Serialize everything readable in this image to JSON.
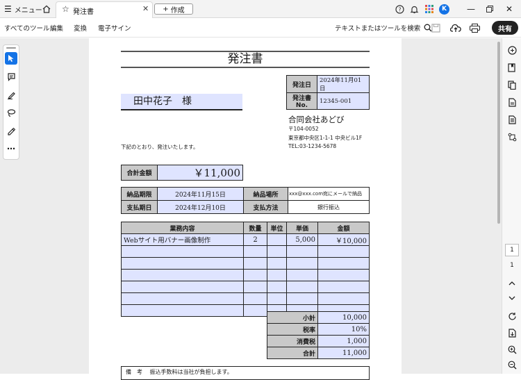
{
  "titlebar": {
    "menu_label": "メニュー",
    "tab_title": "発注書",
    "new_tab_label": "作成",
    "avatar_letter": "K"
  },
  "toolbar": {
    "all_tools": "すべてのツール",
    "edit": "編集",
    "convert": "変換",
    "esign": "電子サイン",
    "search_label": "テキストまたはツールを検索",
    "share": "共有"
  },
  "page_nav": {
    "current_page": "1",
    "total_pages": "1"
  },
  "document": {
    "title": "発注書",
    "order_date_label": "発注日",
    "order_date": "2024年11月01日",
    "order_no_label": "発注書No.",
    "order_no": "12345-001",
    "recipient": "田中花子　様",
    "company_name": "合同会社あどび",
    "postal": "〒104-0052",
    "address": "東京都中央区1-1-1 中央ビル1F",
    "tel": "TEL:03-1234-5678",
    "intro": "下記のとおり、発注いたします。",
    "total_label": "合計金額",
    "total_value": "￥11,000",
    "delivery_deadline_label": "納品期限",
    "delivery_deadline": "2024年11月15日",
    "delivery_place_label": "納品場所",
    "delivery_place": "xxx@xxx.com宛にメールで納品",
    "payment_date_label": "支払期日",
    "payment_date": "2024年12月10日",
    "payment_method_label": "支払方法",
    "payment_method": "銀行振込",
    "items_header": {
      "content": "業務内容",
      "qty": "数量",
      "unit": "単位",
      "price": "単価",
      "amount": "金額"
    },
    "items": [
      {
        "content": "Webサイト用バナー画像制作",
        "qty": "2",
        "unit": "",
        "price": "5,000",
        "amount": "￥10,000"
      }
    ],
    "subtotal_label": "小計",
    "subtotal": "10,000",
    "tax_rate_label": "税率",
    "tax_rate": "10%",
    "tax_label": "消費税",
    "tax": "1,000",
    "grand_total_label": "合計",
    "grand_total": "11,000",
    "remarks_label": "備　考",
    "remarks": "振込手数料は当社が負担します。"
  },
  "colors": {
    "accent_blue": "#2264d1",
    "field_blue": "#dfe4ff",
    "header_gray": "#c9c9c9"
  }
}
